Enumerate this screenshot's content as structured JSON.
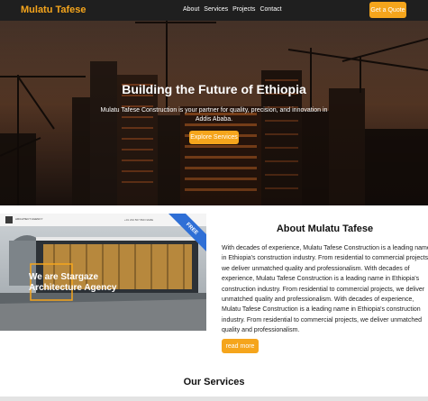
{
  "navbar": {
    "brand": "Mulatu Tafese",
    "links": [
      "About",
      "Services",
      "Projects",
      "Contact"
    ],
    "cta_label": "Get a Quote"
  },
  "hero": {
    "title": "Building the Future of Ethiopia",
    "subtitle": "Mulatu Tafese Construction is your partner for quality, precision, and innovation in Addis Ababa.",
    "button_label": "Explore Services"
  },
  "about": {
    "image": {
      "headline_line1": "We are Stargaze",
      "headline_line2": "Architecture Agency",
      "ribbon": "FREE",
      "logo": "ARCHITECT AGENCY",
      "top_text": "+01 234 567 890 NAME"
    },
    "title": "About Mulatu Tafese",
    "text_lines": [
      "With decades of experience, Mulatu Tafese Construction is a leading name",
      "in Ethiopia's construction industry. From residential to commercial projects,",
      "we deliver unmatched quality and professionalism. With decades of",
      "experience, Mulatu Tafese Construction is a leading name in Ethiopia's",
      "construction industry. From residential to commercial projects, we deliver",
      "unmatched quality and professionalism. With decades of experience,",
      "Mulatu Tafese Construction is a leading name in Ethiopia's construction",
      "industry. From residential to commercial projects, we deliver unmatched",
      "quality and professionalism."
    ],
    "button_label": "read more"
  },
  "services": {
    "title": "Our Services"
  },
  "colors": {
    "accent": "#f5a51c",
    "navbar_bg": "#1f1f1f"
  }
}
